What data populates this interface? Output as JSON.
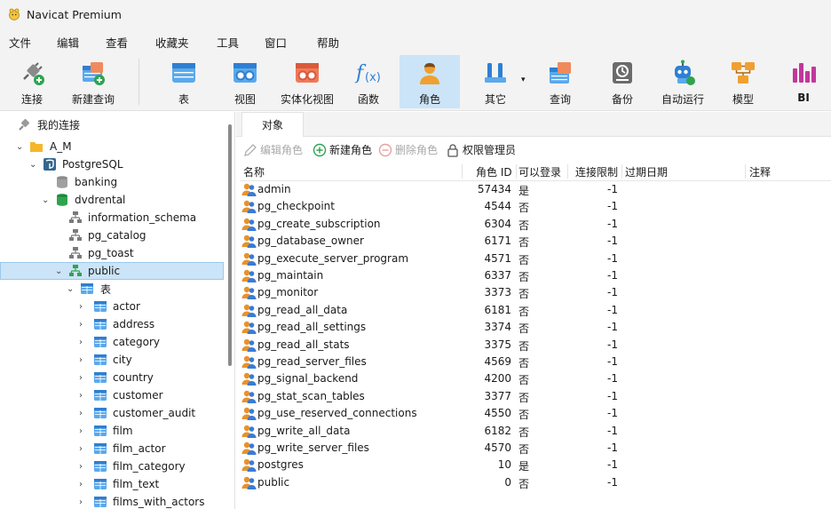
{
  "app": {
    "title": "Navicat Premium"
  },
  "menu": [
    "文件",
    "编辑",
    "查看",
    "收藏夹",
    "工具",
    "窗口",
    "帮助"
  ],
  "toolbar": {
    "connect": "连接",
    "new_query": "新建查询",
    "table": "表",
    "view": "视图",
    "mat_view": "实体化视图",
    "function": "函数",
    "role": "角色",
    "other": "其它",
    "query": "查询",
    "backup": "备份",
    "automation": "自动运行",
    "model": "模型",
    "bi": "BI"
  },
  "sidebar": {
    "header": "我的连接",
    "group": "A_M",
    "connection": "PostgreSQL",
    "dbs": [
      "banking",
      "dvdrental"
    ],
    "schemas": [
      "information_schema",
      "pg_catalog",
      "pg_toast",
      "public"
    ],
    "table_folder": "表",
    "tables": [
      "actor",
      "address",
      "category",
      "city",
      "country",
      "customer",
      "customer_audit",
      "film",
      "film_actor",
      "film_category",
      "film_text",
      "films_with_actors"
    ]
  },
  "main": {
    "tab": "对象",
    "actions": {
      "edit": "编辑角色",
      "new": "新建角色",
      "delete": "删除角色",
      "perm": "权限管理员"
    },
    "columns": {
      "name": "名称",
      "role_id": "角色 ID",
      "can_login": "可以登录",
      "conn_limit": "连接限制",
      "expire": "过期日期",
      "comment": "注释"
    },
    "roles": [
      {
        "name": "admin",
        "id": "57434",
        "login": "是",
        "limit": "-1"
      },
      {
        "name": "pg_checkpoint",
        "id": "4544",
        "login": "否",
        "limit": "-1"
      },
      {
        "name": "pg_create_subscription",
        "id": "6304",
        "login": "否",
        "limit": "-1"
      },
      {
        "name": "pg_database_owner",
        "id": "6171",
        "login": "否",
        "limit": "-1"
      },
      {
        "name": "pg_execute_server_program",
        "id": "4571",
        "login": "否",
        "limit": "-1"
      },
      {
        "name": "pg_maintain",
        "id": "6337",
        "login": "否",
        "limit": "-1"
      },
      {
        "name": "pg_monitor",
        "id": "3373",
        "login": "否",
        "limit": "-1"
      },
      {
        "name": "pg_read_all_data",
        "id": "6181",
        "login": "否",
        "limit": "-1"
      },
      {
        "name": "pg_read_all_settings",
        "id": "3374",
        "login": "否",
        "limit": "-1"
      },
      {
        "name": "pg_read_all_stats",
        "id": "3375",
        "login": "否",
        "limit": "-1"
      },
      {
        "name": "pg_read_server_files",
        "id": "4569",
        "login": "否",
        "limit": "-1"
      },
      {
        "name": "pg_signal_backend",
        "id": "4200",
        "login": "否",
        "limit": "-1"
      },
      {
        "name": "pg_stat_scan_tables",
        "id": "3377",
        "login": "否",
        "limit": "-1"
      },
      {
        "name": "pg_use_reserved_connections",
        "id": "4550",
        "login": "否",
        "limit": "-1"
      },
      {
        "name": "pg_write_all_data",
        "id": "6182",
        "login": "否",
        "limit": "-1"
      },
      {
        "name": "pg_write_server_files",
        "id": "4570",
        "login": "否",
        "limit": "-1"
      },
      {
        "name": "postgres",
        "id": "10",
        "login": "是",
        "limit": "-1"
      },
      {
        "name": "public",
        "id": "0",
        "login": "否",
        "limit": "-1"
      }
    ]
  },
  "colors": {
    "selected_bg": "#cce4f7",
    "accent": "#1e88e5",
    "role_icon": "#f0a030"
  }
}
